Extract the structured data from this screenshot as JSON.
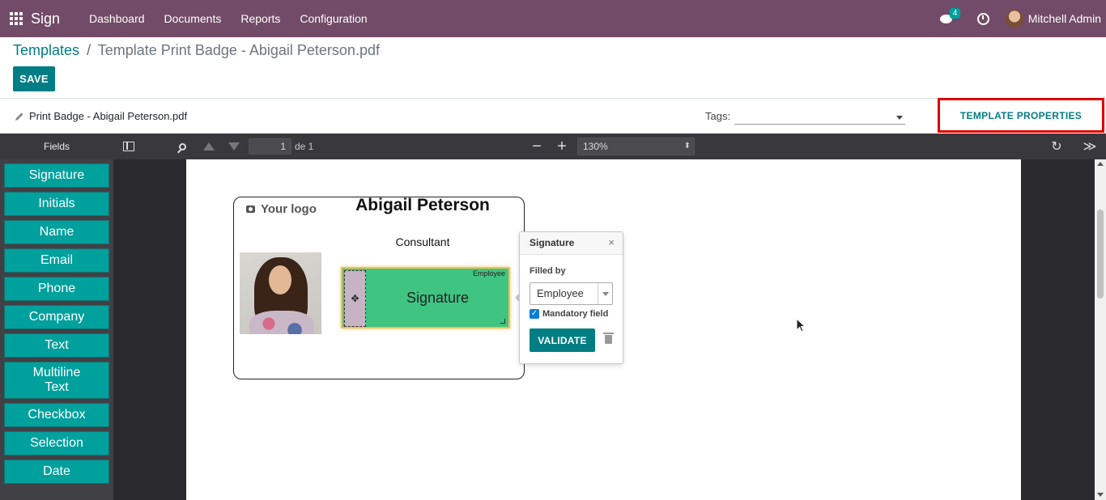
{
  "navbar": {
    "app_name": "Sign",
    "menu": [
      "Dashboard",
      "Documents",
      "Reports",
      "Configuration"
    ],
    "messages_count": "4",
    "user_name": "Mitchell Admin",
    "bg_color": "#714B67"
  },
  "breadcrumb": {
    "parent": "Templates",
    "separator": "/",
    "current": "Template Print Badge - Abigail Peterson.pdf"
  },
  "actions": {
    "save_label": "SAVE"
  },
  "template_bar": {
    "name": "Print Badge - Abigail Peterson.pdf",
    "tags_label": "Tags:",
    "tags_value": "",
    "properties_label": "TEMPLATE PROPERTIES"
  },
  "pdf_toolbar": {
    "fields_label": "Fields",
    "page_number": "1",
    "page_of": "de 1",
    "zoom_out": "−",
    "zoom_in": "+",
    "zoom": "130%",
    "reload": "↻",
    "more": "≫"
  },
  "fields": [
    "Signature",
    "Initials",
    "Name",
    "Email",
    "Phone",
    "Company",
    "Text",
    "Multiline Text",
    "Checkbox",
    "Selection",
    "Date"
  ],
  "badge": {
    "logo_text": "Your logo",
    "employee_name": "Abigail Peterson",
    "job_title": "Consultant"
  },
  "signature_field": {
    "handle": "✥",
    "role": "Employee",
    "label": "Signature"
  },
  "popover": {
    "title": "Signature",
    "close": "×",
    "filled_by_label": "Filled by",
    "filled_by_value": "Employee",
    "mandatory_checked": true,
    "mandatory_check": "✓",
    "mandatory_label": "Mandatory field",
    "validate_label": "VALIDATE"
  },
  "colors": {
    "primary": "#017e84",
    "field_button": "#00A09D",
    "signature_field": "#3fc581",
    "highlight_border": "#e00000"
  }
}
